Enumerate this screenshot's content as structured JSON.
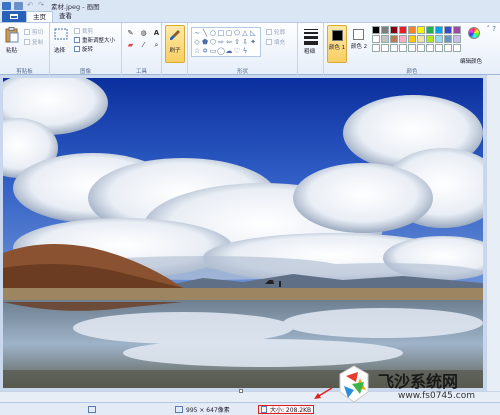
{
  "window": {
    "title": "素材.jpeg - 画图"
  },
  "tabs": [
    {
      "label": "主页"
    },
    {
      "label": "查看"
    }
  ],
  "clipboard": {
    "group_label": "剪贴板",
    "paste": "粘贴",
    "cut": "剪切",
    "copy": "复制"
  },
  "image": {
    "group_label": "图像",
    "select": "选择",
    "crop": "裁剪",
    "resize": "重新调整大小",
    "rotate": "旋转"
  },
  "tools": {
    "group_label": "工具",
    "items": [
      "pencil-icon",
      "fill-icon",
      "text-icon",
      "eraser-icon",
      "color-picker-icon",
      "magnifier-icon"
    ]
  },
  "brushes": {
    "label": "刷子"
  },
  "shapes": {
    "group_label": "形状",
    "outline": "轮廓",
    "fill": "填充"
  },
  "size": {
    "label": "粗细"
  },
  "colors": {
    "group_label": "颜色",
    "color1_label": "颜色 1",
    "color2_label": "颜色 2",
    "edit_label": "编辑颜色",
    "palette": [
      "#000000",
      "#7f7f7f",
      "#880015",
      "#ed1c24",
      "#ff7f27",
      "#fff200",
      "#22b14c",
      "#00a2e8",
      "#3f48cc",
      "#a349a4",
      "#ffffff",
      "#c3c3c3",
      "#b97a57",
      "#ffaec9",
      "#ffc90e",
      "#efe4b0",
      "#b5e61d",
      "#99d9ea",
      "#7092be",
      "#c8bfe7",
      "#ffffff",
      "#ffffff",
      "#ffffff",
      "#ffffff",
      "#ffffff",
      "#ffffff",
      "#ffffff",
      "#ffffff",
      "#ffffff",
      "#ffffff"
    ]
  },
  "status": {
    "dimensions": "995 × 647像素",
    "file_size": "大小: 208.2KB"
  },
  "watermark": {
    "name": "飞沙系统网",
    "url": "www.fs0745.com"
  }
}
